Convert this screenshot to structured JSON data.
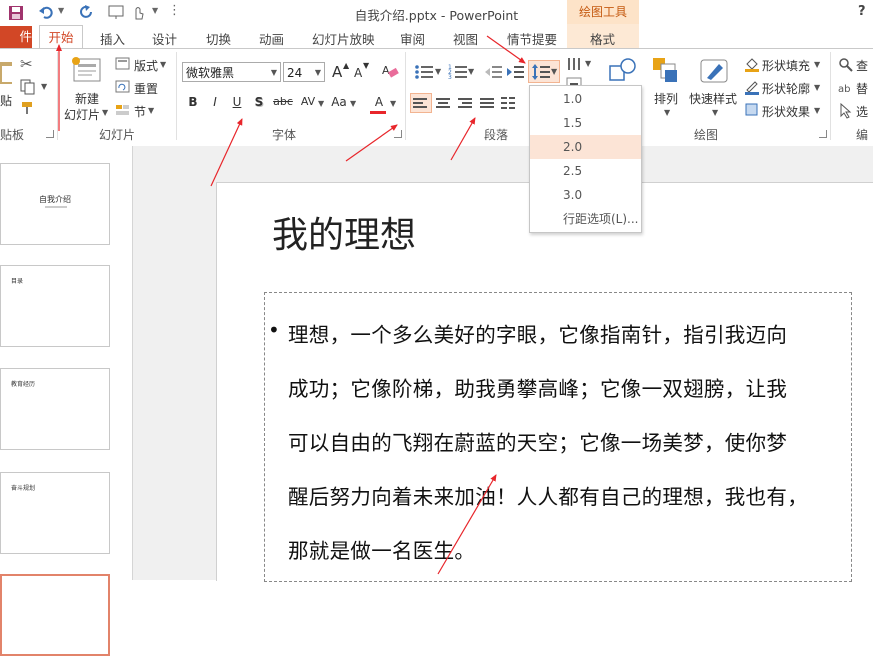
{
  "window": {
    "title": "自我介绍.pptx - PowerPoint",
    "contextual_group": "绘图工具",
    "help": "?"
  },
  "tabs": {
    "file": "件",
    "home": "开始",
    "items": [
      "插入",
      "设计",
      "切换",
      "动画",
      "幻灯片放映",
      "审阅",
      "视图",
      "情节提要",
      "格式"
    ]
  },
  "ribbon": {
    "clipboard": {
      "paste": "贴",
      "label": "贴板"
    },
    "slides": {
      "new_slide_1": "新建",
      "new_slide_2": "幻灯片",
      "layout": "版式",
      "reset": "重置",
      "section": "节",
      "label": "幻灯片"
    },
    "font": {
      "name": "微软雅黑",
      "size": "24",
      "bold": "B",
      "italic": "I",
      "underline": "U",
      "shadow": "S",
      "strike": "abc",
      "spacing": "AV",
      "case": "Aa",
      "color": "A",
      "grow": "A",
      "shrink": "A",
      "label": "字体"
    },
    "paragraph": {
      "label": "段落"
    },
    "drawing": {
      "arrange": "排列",
      "quick_styles": "快速样式",
      "shape_fill": "形状填充",
      "shape_outline": "形状轮廓",
      "shape_effects": "形状效果",
      "label": "绘图"
    },
    "editing": {
      "find": "查",
      "replace": "替",
      "select": "选",
      "label": "编"
    }
  },
  "line_spacing_menu": {
    "items": [
      "1.0",
      "1.5",
      "2.0",
      "2.5",
      "3.0",
      "行距选项(L)..."
    ],
    "selected": "2.0"
  },
  "thumbnails": [
    {
      "title": "自我介绍",
      "subtitle": ""
    },
    {
      "title": "目录",
      "subtitle": ""
    },
    {
      "title": "教育经历",
      "subtitle": ""
    },
    {
      "title": "奋斗规划",
      "subtitle": ""
    }
  ],
  "slide": {
    "title": "我的理想",
    "bullet": "•",
    "body_lines": [
      "理想，一个多么美好的字眼，它像指南针，指引我迈向",
      "成功；它像阶梯，助我勇攀高峰；它像一双翅膀，让我",
      "可以自由的飞翔在蔚蓝的天空；它像一场美梦，使你梦",
      "醒后努力向着未来加油！人人都有自己的理想，我也有，",
      "那就是做一名医生。"
    ]
  },
  "colors": {
    "accent": "#d24726",
    "contextual": "#fde3c8",
    "selected_item": "#fce4d6",
    "annotation_arrow": "#e8262b"
  }
}
